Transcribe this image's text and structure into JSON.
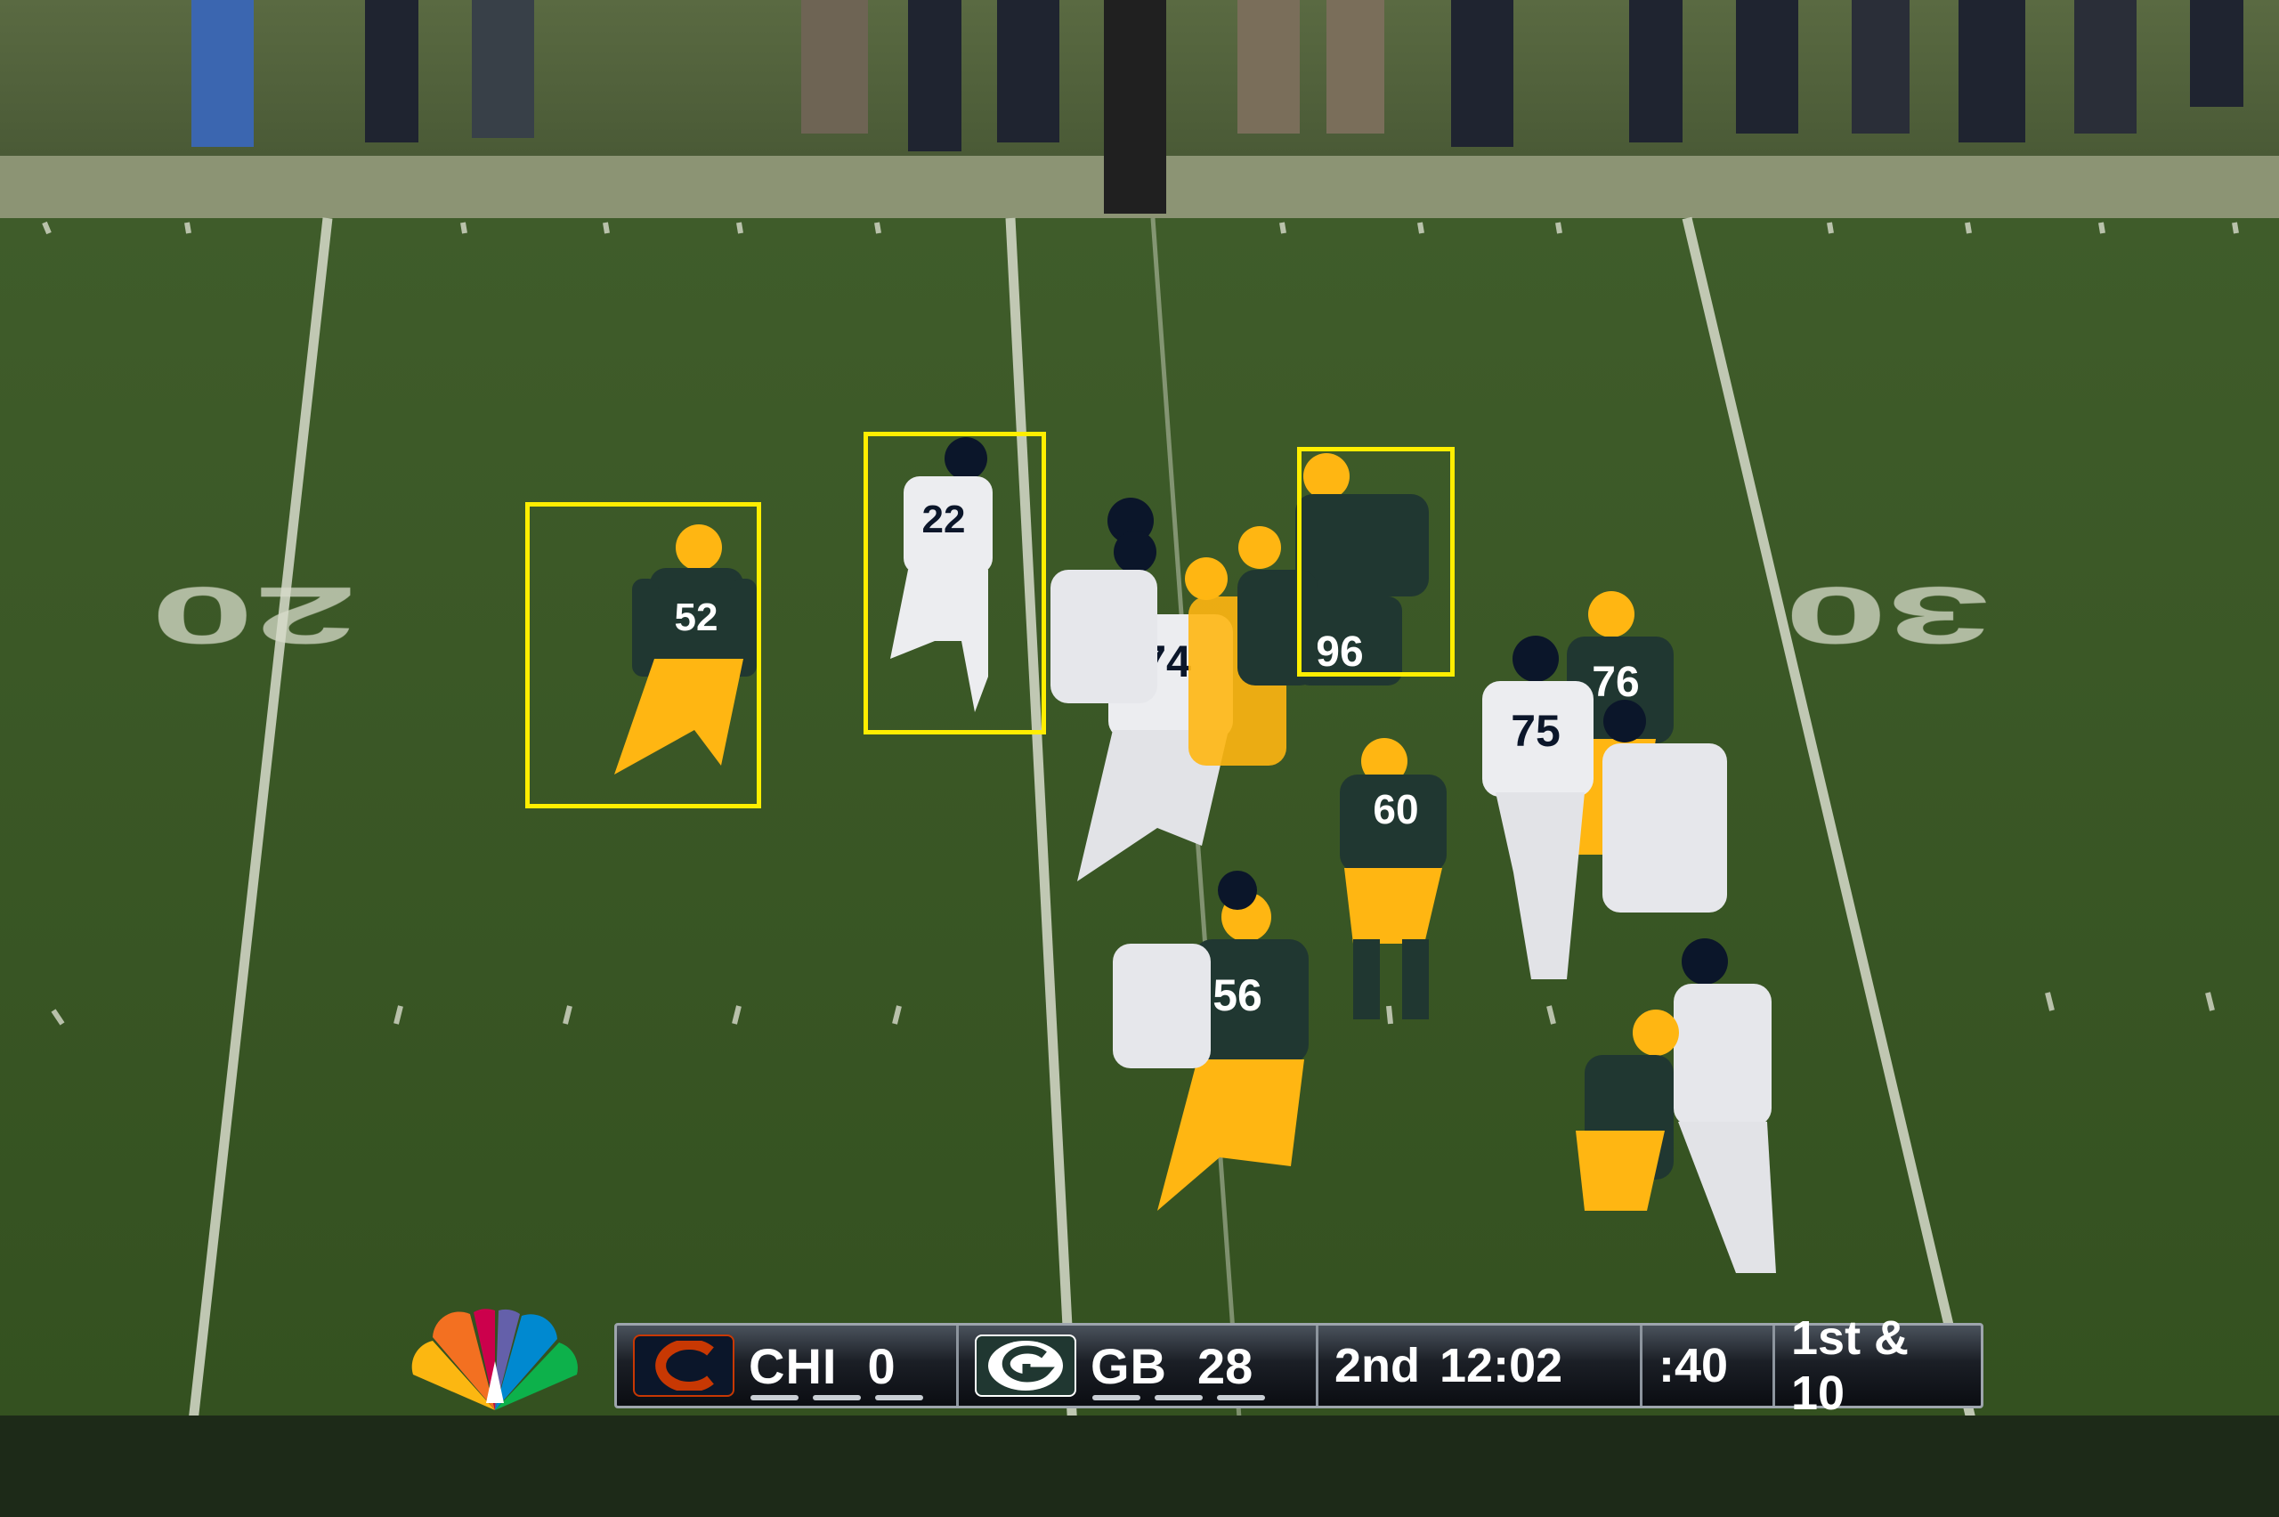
{
  "scene": {
    "field_numbers": [
      "20",
      "20",
      "30",
      "30"
    ],
    "jerseys": [
      "52",
      "22",
      "74",
      "96",
      "76",
      "75",
      "60",
      "56"
    ],
    "colors": {
      "turf": "#3d5a27",
      "packers_green": "#203731",
      "packers_gold": "#ffb612",
      "bears_navy": "#0b162a",
      "bears_orange": "#c83803",
      "highlight": "#ffee00"
    }
  },
  "highlights": [
    {
      "player": "52"
    },
    {
      "player": "22"
    },
    {
      "player": "96"
    }
  ],
  "scorebug": {
    "away": {
      "logo": "bears-c-logo",
      "abbr": "CHI",
      "score": "0",
      "color": "#0b162a"
    },
    "home": {
      "logo": "packers-g-logo",
      "abbr": "GB",
      "score": "28",
      "color": "#203731"
    },
    "period": "2nd",
    "clock": "12:02",
    "play_clock": ":40",
    "down_distance": "1st & 10"
  },
  "network": {
    "logo": "nbc-peacock-logo"
  }
}
